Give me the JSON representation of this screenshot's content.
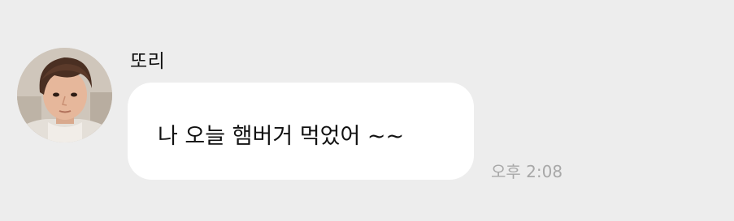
{
  "message": {
    "sender_name": "또리",
    "text": "나 오늘 햄버거 먹었어 ~~",
    "time": "오후 2:08"
  },
  "colors": {
    "background": "#ededed",
    "bubble": "#ffffff",
    "timestamp": "#a8a8a8",
    "text": "#111111"
  },
  "icons": {
    "avatar": "profile-photo"
  }
}
